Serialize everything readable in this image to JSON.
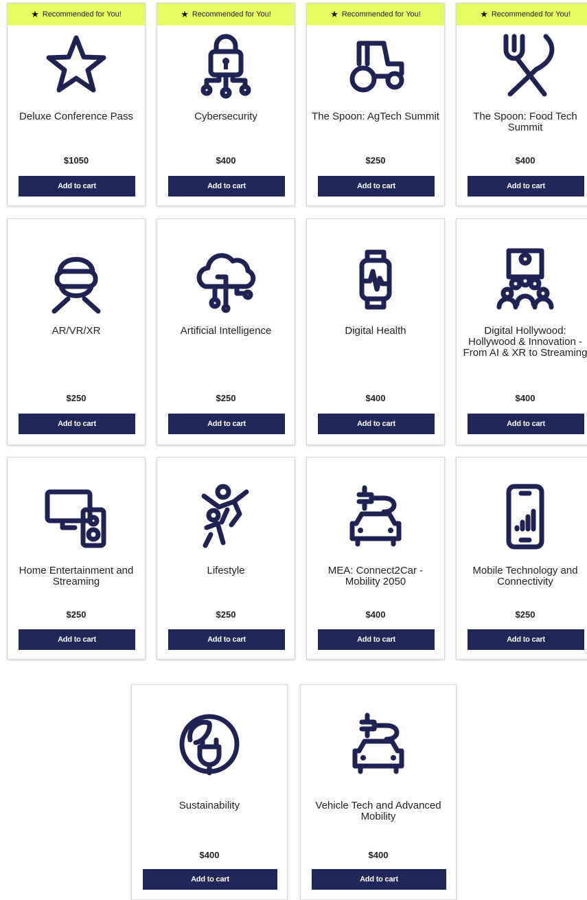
{
  "recommended_label": "Recommended for You!",
  "add_to_cart_label": "Add to cart",
  "colors": {
    "accent": "#e5fb61",
    "button": "#22275a",
    "icon": "#1f2252"
  },
  "products": [
    {
      "title": "Deluxe Conference Pass",
      "price": "$1050",
      "icon": "star-icon",
      "recommended": true
    },
    {
      "title": "Cybersecurity",
      "price": "$400",
      "icon": "padlock-network-icon",
      "recommended": true
    },
    {
      "title": "The Spoon: AgTech Summit",
      "price": "$250",
      "icon": "tractor-icon",
      "recommended": true
    },
    {
      "title": "The Spoon: Food Tech Summit",
      "price": "$400",
      "icon": "fork-knife-icon",
      "recommended": true
    },
    {
      "title": "AR/VR/XR",
      "price": "$250",
      "icon": "vr-headset-person-icon",
      "recommended": false
    },
    {
      "title": "Artificial Intelligence",
      "price": "$250",
      "icon": "cloud-circuit-icon",
      "recommended": false
    },
    {
      "title": "Digital Health",
      "price": "$400",
      "icon": "smartwatch-heartbeat-icon",
      "recommended": false
    },
    {
      "title": "Digital Hollywood: Hollywood & Innovation - From AI & XR to Streaming",
      "price": "$400",
      "icon": "audience-screen-icon",
      "recommended": false
    },
    {
      "title": "Home Entertainment and Streaming",
      "price": "$250",
      "icon": "monitor-speaker-icon",
      "recommended": false
    },
    {
      "title": "Lifestyle",
      "price": "$250",
      "icon": "people-celebrating-icon",
      "recommended": false
    },
    {
      "title": "MEA: Connect2Car - Mobility 2050",
      "price": "$400",
      "icon": "electric-car-icon",
      "recommended": false
    },
    {
      "title": "Mobile Technology and Connectivity",
      "price": "$250",
      "icon": "smartphone-signal-icon",
      "recommended": false
    },
    {
      "title": "Sustainability",
      "price": "$400",
      "icon": "leaf-plug-icon",
      "recommended": false
    },
    {
      "title": "Vehicle Tech and Advanced Mobility",
      "price": "$400",
      "icon": "electric-car-icon",
      "recommended": false
    }
  ]
}
